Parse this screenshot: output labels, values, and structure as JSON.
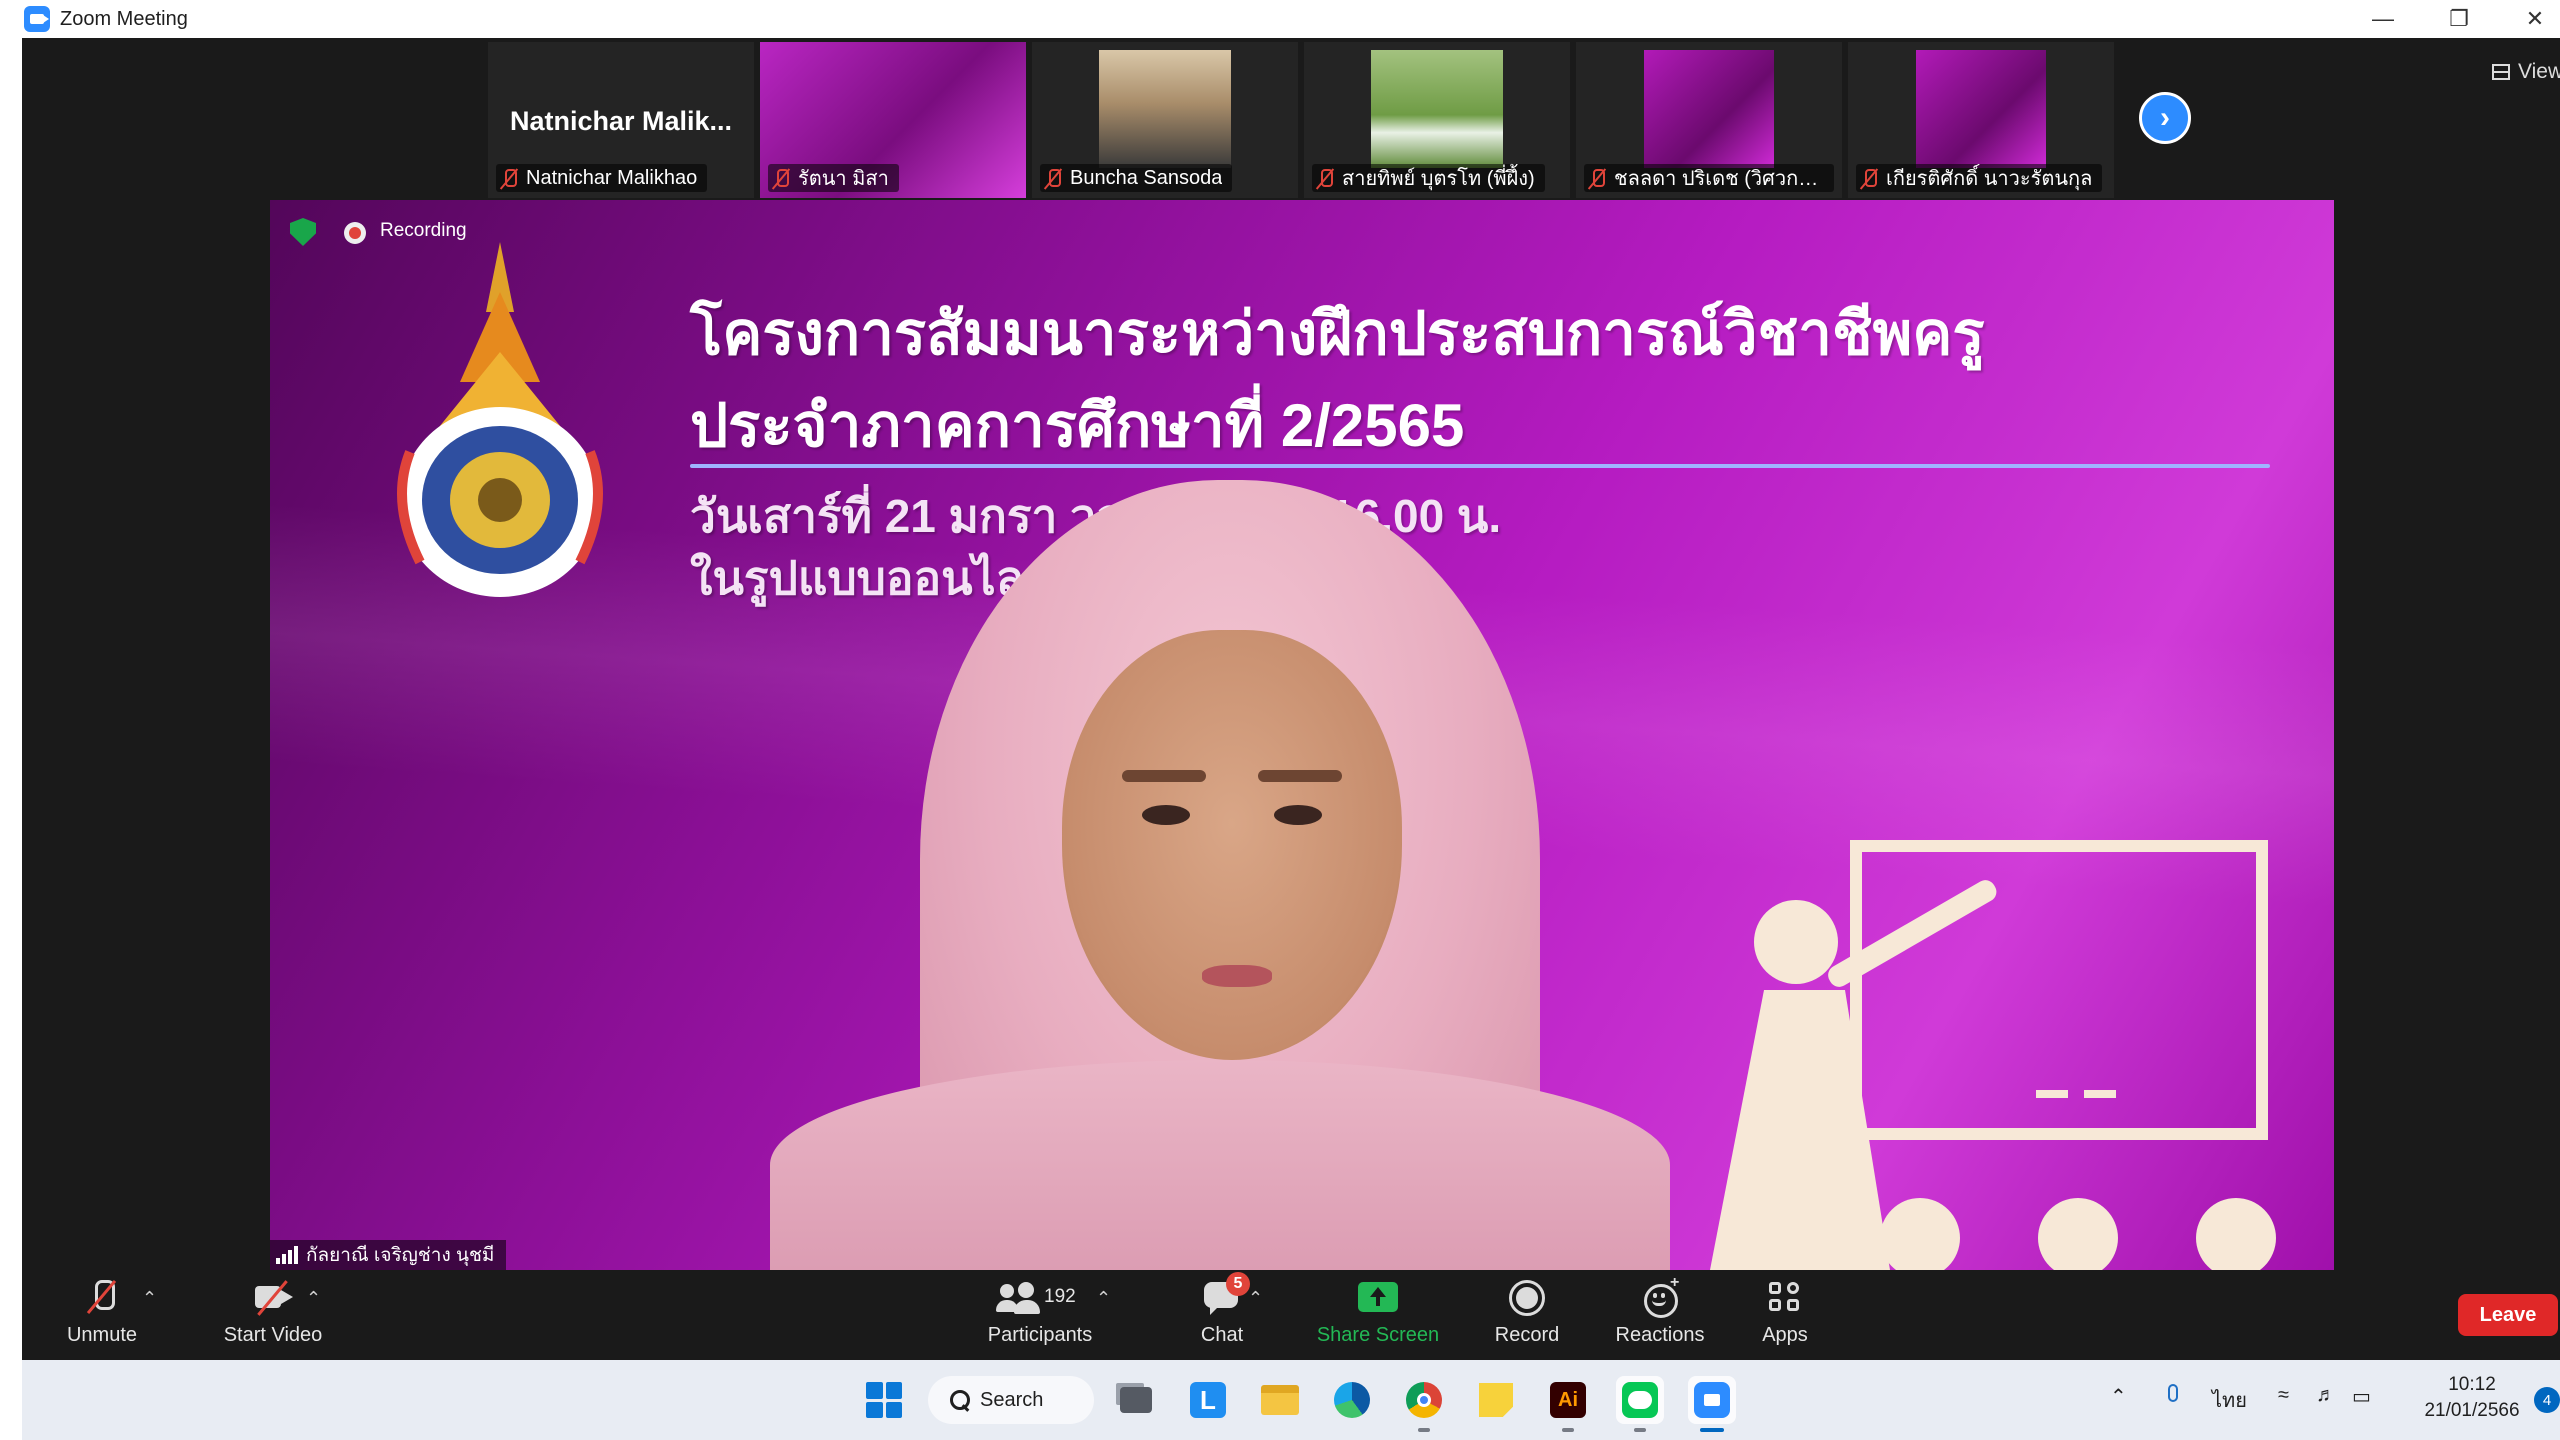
{
  "window": {
    "title": "Zoom Meeting",
    "controls": [
      "minimize",
      "restore",
      "close"
    ]
  },
  "filmstrip": {
    "tiles": [
      {
        "display": "Natnichar  Malik...",
        "name": "Natnichar Malikhao",
        "muted": true,
        "kind": "name-only"
      },
      {
        "name": "รัตนา มิสา",
        "muted": true,
        "kind": "slide-share"
      },
      {
        "name": "Buncha Sansoda",
        "muted": true,
        "kind": "person"
      },
      {
        "name": "สายทิพย์ บุตรโท (พี่ฝึ้ง)",
        "muted": true,
        "kind": "outdoor"
      },
      {
        "name": "ชลลดา ปริเดช (วิศวกรรม...",
        "muted": true,
        "kind": "slide"
      },
      {
        "name": "เกียรติศักดิ์ นาวะรัตนกุล",
        "muted": true,
        "kind": "slide"
      }
    ],
    "next_icon": "chevron-right-icon",
    "view_label": "View"
  },
  "speaker": {
    "recording_label": "Recording",
    "name": "กัลยาณี เจริญช่าง นุชมี",
    "slide": {
      "line1": "โครงการสัมมนาระหว่างฝึกประสบการณ์วิชาชีพครู",
      "line2": "ประจำภาคการศึกษาที่ 2/2565",
      "line3": "วันเสาร์ที่ 21 มกรา                    วลา 08.00 – 16.00 น.",
      "line4": "ในรูปแบบออนไล                               ing Online"
    }
  },
  "toolbar": {
    "unmute": "Unmute",
    "start_video": "Start Video",
    "participants": "Participants",
    "participants_count": "192",
    "chat": "Chat",
    "chat_badge": "5",
    "share_screen": "Share Screen",
    "record": "Record",
    "reactions": "Reactions",
    "apps": "Apps",
    "leave": "Leave"
  },
  "taskbar": {
    "search_label": "Search",
    "language": "ไทย",
    "time": "10:12",
    "date": "21/01/2566",
    "notification_count": "4",
    "apps": [
      "start-icon",
      "task-view-icon",
      "lark-icon",
      "file-explorer-icon",
      "edge-icon",
      "chrome-icon",
      "sticky-notes-icon",
      "illustrator-icon",
      "line-icon",
      "zoom-icon"
    ]
  },
  "colors": {
    "zoom_blue": "#2D8CFF",
    "leave_red": "#E02828",
    "share_green": "#23B855",
    "slide_purple": "#B51BC1",
    "toolbar_bg": "#1A1A1A"
  }
}
